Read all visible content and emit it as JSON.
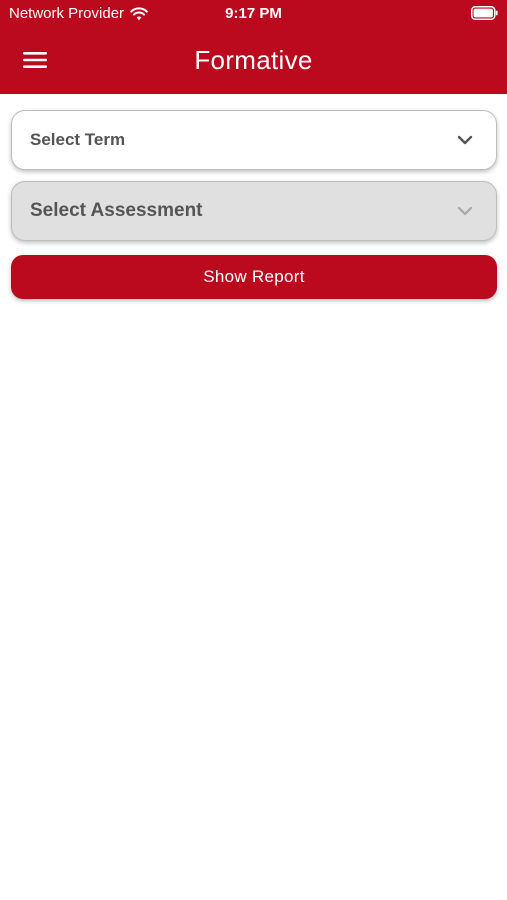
{
  "status_bar": {
    "carrier": "Network Provider",
    "time": "9:17 PM",
    "wifi_icon": "wifi-icon",
    "battery_icon": "battery-icon"
  },
  "header": {
    "title": "Formative",
    "menu_icon": "hamburger-menu-icon"
  },
  "form": {
    "term_select": {
      "placeholder": "Select Term",
      "icon": "chevron-down-icon"
    },
    "assessment_select": {
      "placeholder": "Select Assessment",
      "icon": "chevron-down-icon"
    },
    "show_report_label": "Show Report"
  },
  "colors": {
    "brand": "#bb0a1e",
    "disabled_field": "#e0e0e0",
    "label_text": "#555555"
  }
}
